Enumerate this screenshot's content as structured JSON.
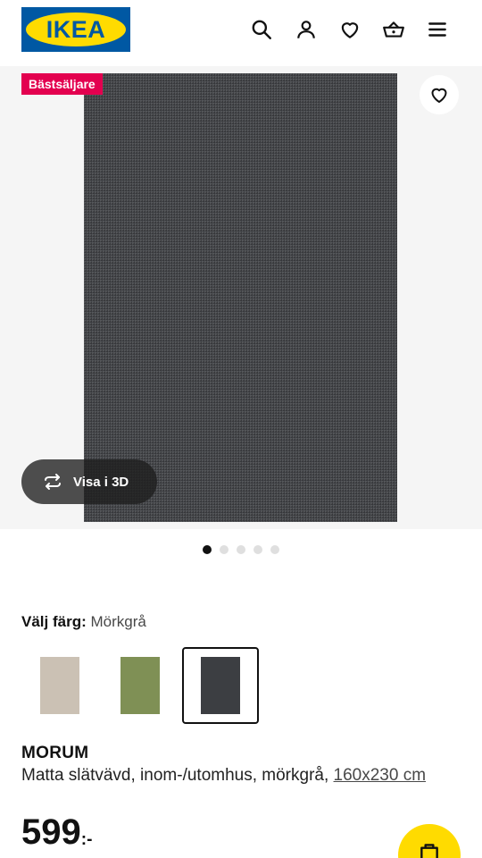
{
  "header": {
    "logo_text": "IKEA",
    "icons": [
      "search-icon",
      "user-icon",
      "heart-icon",
      "basket-icon",
      "menu-icon"
    ]
  },
  "gallery": {
    "badge": "Bästsäljare",
    "view_3d_label": "Visa i 3D",
    "slide_count": 5,
    "active_slide": 1
  },
  "color_selector": {
    "label": "Välj färg:",
    "value": "Mörkgrå",
    "options": [
      {
        "name": "beige",
        "color": "#cbc1b4"
      },
      {
        "name": "green",
        "color": "#7f9055"
      },
      {
        "name": "dark-grey",
        "color": "#3c3e42",
        "selected": true
      }
    ]
  },
  "product": {
    "name": "MORUM",
    "description": "Matta slätvävd, inom-/utomhus, mörkgrå,",
    "size": "160x230 cm",
    "price": "599",
    "price_suffix": ":-"
  },
  "colors": {
    "ikea_blue": "#0058a3",
    "ikea_yellow": "#ffdb00",
    "badge_pink": "#e3004f"
  }
}
